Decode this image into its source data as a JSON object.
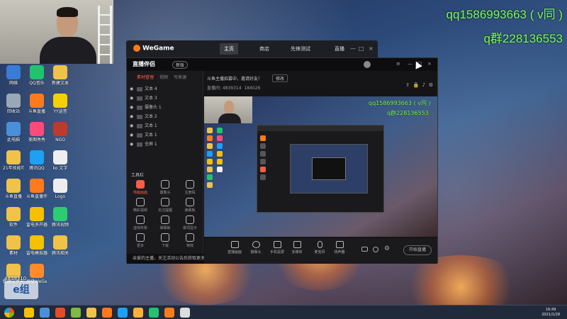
{
  "overlay": {
    "qq_line": "qq1586993663 ( v同 )",
    "group_line": "q群228136553"
  },
  "desktop_icons": [
    {
      "label": "网络",
      "color": "#3a7bd5"
    },
    {
      "label": "回收站",
      "color": "#9aa7b8"
    },
    {
      "label": "此电脑",
      "color": "#4a90d9"
    },
    {
      "label": "21年技能可更新用",
      "color": "#f0c24a"
    },
    {
      "label": "斗鱼直播",
      "color": "#f0c24a"
    },
    {
      "label": "软件",
      "color": "#f0c24a"
    },
    {
      "label": "素材",
      "color": "#f0c24a"
    },
    {
      "label": "新建文件夹",
      "color": "#f0c24a"
    },
    {
      "label": "QQ音乐",
      "color": "#21c36f"
    },
    {
      "label": "斗鱼直播",
      "color": "#ff7a1a"
    },
    {
      "label": "美图秀秀",
      "color": "#ff4a7a"
    },
    {
      "label": "腾讯QQ",
      "color": "#1da1f2"
    },
    {
      "label": "斗鱼直播伴侣",
      "color": "#ff7a1a"
    },
    {
      "label": "雷电多开器",
      "color": "#f5c000"
    },
    {
      "label": "雷电模拟器",
      "color": "#f5c000"
    },
    {
      "label": "高级WeGame",
      "color": "#ff8a2a"
    },
    {
      "label": "新建文本",
      "color": "#f0c24a"
    },
    {
      "label": "YY语音",
      "color": "#f5d000"
    },
    {
      "label": "NGO",
      "color": "#c0392b"
    },
    {
      "label": "ko 文字",
      "color": "#eeeeee"
    },
    {
      "label": "Logo",
      "color": "#eeeeee"
    },
    {
      "label": "腾讯视频",
      "color": "#2ecc71"
    },
    {
      "label": "腾讯相关",
      "color": "#f0c24a"
    }
  ],
  "wegame": {
    "brand": "WeGame",
    "tabs": [
      "主页",
      "商店",
      "先锋测试",
      "直播"
    ],
    "active_tab": "主页",
    "controls": [
      "—",
      "□",
      "×"
    ]
  },
  "app": {
    "logo": "直播伴侣",
    "badge": "新版",
    "left_tabs": [
      "素材管理",
      "视频",
      "写来源"
    ],
    "sources": [
      "文本 4",
      "文本 3",
      "摄像头 1",
      "文本 2",
      "文本 1",
      "文本 1",
      "全屏 1"
    ],
    "tools_title": "工具栏",
    "tools": [
      {
        "label": "电脑画面",
        "hot": true
      },
      {
        "label": "摄像头",
        "hot": false
      },
      {
        "label": "注册码",
        "hot": false
      },
      {
        "label": "精彩视频",
        "hot": false
      },
      {
        "label": "关注提醒",
        "hot": false
      },
      {
        "label": "弹幕板",
        "hot": false
      },
      {
        "label": "虚拟形象",
        "hot": false
      },
      {
        "label": "弹幕板",
        "hot": false
      },
      {
        "label": "歌词显示",
        "hot": false
      },
      {
        "label": "更多",
        "hot": false
      },
      {
        "label": "下载",
        "hot": false
      },
      {
        "label": "特效",
        "hot": false
      }
    ],
    "notice": "亲爱的主播，关注活动公告后获取更多直播福利",
    "room_line": "斗鱼主播招募中，邀请好友！",
    "room_btn": "修改",
    "room_meta": "直播间: 4839314",
    "room_count": "184026",
    "bottom_buttons": [
      "直播画面",
      "摄像头",
      "手机投屏",
      "多媒体",
      "麦克风",
      "扬声器"
    ],
    "start_label": "开始直播"
  },
  "preview": {
    "qq_line": "qq1586993663 ( v同 )",
    "group_line": "q群228136553"
  },
  "bottom_left": {
    "counter": "4839310",
    "logo": "e组"
  },
  "taskbar": {
    "apps": [
      "#f5c000",
      "#4a90d9",
      "#e34c26",
      "#7dbb42",
      "#f0c24a",
      "#ff7a1a",
      "#1da1f2",
      "#ffb03a",
      "#21c36f",
      "#ff7a1a",
      "#ddd"
    ],
    "time": "16:49",
    "date": "2021/1/28"
  }
}
